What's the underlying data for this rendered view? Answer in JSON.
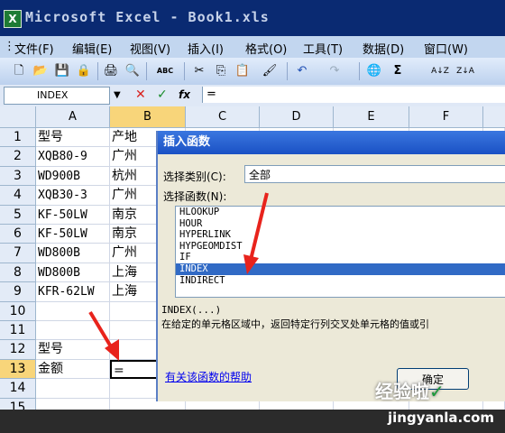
{
  "titlebar": {
    "title": "Microsoft Excel - Book1.xls",
    "icon": "excel-icon"
  },
  "menu": [
    "文件(F)",
    "编辑(E)",
    "视图(V)",
    "插入(I)",
    "格式(O)",
    "工具(T)",
    "数据(D)",
    "窗口(W)"
  ],
  "toolbar": {
    "new": "🗋",
    "open": "📂",
    "save": "💾",
    "permission": "🔒",
    "print": "🖨",
    "preview": "🔍",
    "spell": "ABC",
    "cut": "✂",
    "copy": "⎘",
    "paste": "📋",
    "format_painter": "🖌",
    "undo": "↶",
    "redo": "↷",
    "hyperlink": "🌐",
    "autosum": "Σ",
    "sort_asc": "A↓Z",
    "sort_desc": "Z↓A"
  },
  "formula_bar": {
    "name_box": "INDEX",
    "cancel": "✕",
    "enter": "✓",
    "fx": "fx",
    "formula": "="
  },
  "columns": [
    "A",
    "B",
    "C",
    "D",
    "E",
    "F"
  ],
  "rows": [
    {
      "n": "1",
      "a": "型号",
      "b": "产地"
    },
    {
      "n": "2",
      "a": "XQB80-9",
      "b": "广州"
    },
    {
      "n": "3",
      "a": "WD900B",
      "b": "杭州"
    },
    {
      "n": "4",
      "a": "XQB30-3",
      "b": "广州"
    },
    {
      "n": "5",
      "a": "KF-50LW",
      "b": "南京"
    },
    {
      "n": "6",
      "a": "KF-50LW",
      "b": "南京"
    },
    {
      "n": "7",
      "a": "WD800B",
      "b": "广州"
    },
    {
      "n": "8",
      "a": "WD800B",
      "b": "上海"
    },
    {
      "n": "9",
      "a": "KFR-62LW",
      "b": "上海"
    },
    {
      "n": "10",
      "a": "",
      "b": ""
    },
    {
      "n": "11",
      "a": "",
      "b": ""
    },
    {
      "n": "12",
      "a": "型号",
      "b": ""
    },
    {
      "n": "13",
      "a": "金额",
      "b": "="
    },
    {
      "n": "14",
      "a": "",
      "b": ""
    },
    {
      "n": "15",
      "a": "",
      "b": ""
    }
  ],
  "dialog": {
    "title": "插入函数",
    "category_label": "选择类别(C):",
    "category_value": "全部",
    "function_label": "选择函数(N):",
    "functions": [
      "HLOOKUP",
      "HOUR",
      "HYPERLINK",
      "HYPGEOMDIST",
      "IF",
      "INDEX",
      "INDIRECT"
    ],
    "selected_function": "INDEX",
    "syntax": "INDEX(...)",
    "description": "在给定的单元格区域中，返回特定行列交叉处单元格的值或引",
    "help_link": "有关该函数的帮助",
    "ok_button": "确定"
  },
  "watermark": {
    "text": "经验啦",
    "check": "✓",
    "url": "jingyanla.com"
  },
  "colors": {
    "titlebar": "#0a2a72",
    "menubar": "#c2d6ef",
    "selection": "#316ac5",
    "header_selected": "#f8d57a",
    "arrow": "#e8231c"
  }
}
